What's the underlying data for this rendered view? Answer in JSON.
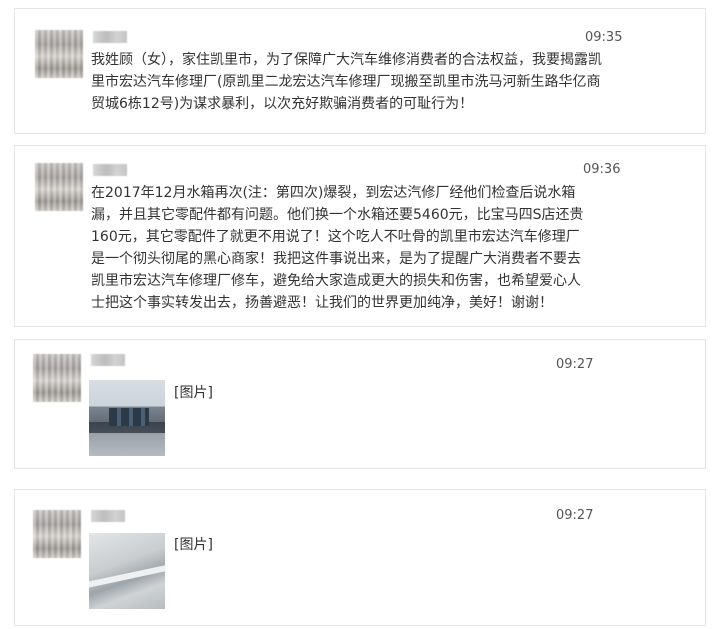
{
  "messages": [
    {
      "time": "09:35",
      "text": "我姓顾（女），家住凯里市，为了保障广大汽车维修消费者的合法权益，我要揭露凯里市宏达汽车修理厂(原凯里二龙宏达汽车修理厂现搬至凯里市洗马河新生路华亿商贸城6栋12号)为谋求暴利，以次充好欺骗消费者的可耻行为！"
    },
    {
      "time": "09:36",
      "text": "在2017年12月水箱再次(注：第四次)爆裂，到宏达汽修厂经他们检查后说水箱漏，并且其它零配件都有问题。他们换一个水箱还要5460元，比宝马四S店还贵160元，其它零配件了就更不用说了！这个吃人不吐骨的凯里市宏达汽车修理厂是一个彻头彻尾的黑心商家！我把这件事说出来，是为了提醒广大消费者不要去凯里市宏达汽车修理厂修车，避免给大家造成更大的损失和伤害，也希望爱心人士把这个事实转发出去，扬善避恶！让我们的世界更加纯净，美好！谢谢！"
    },
    {
      "time": "09:27",
      "image_label": "[图片]"
    },
    {
      "time": "09:27",
      "image_label": "[图片]"
    }
  ]
}
